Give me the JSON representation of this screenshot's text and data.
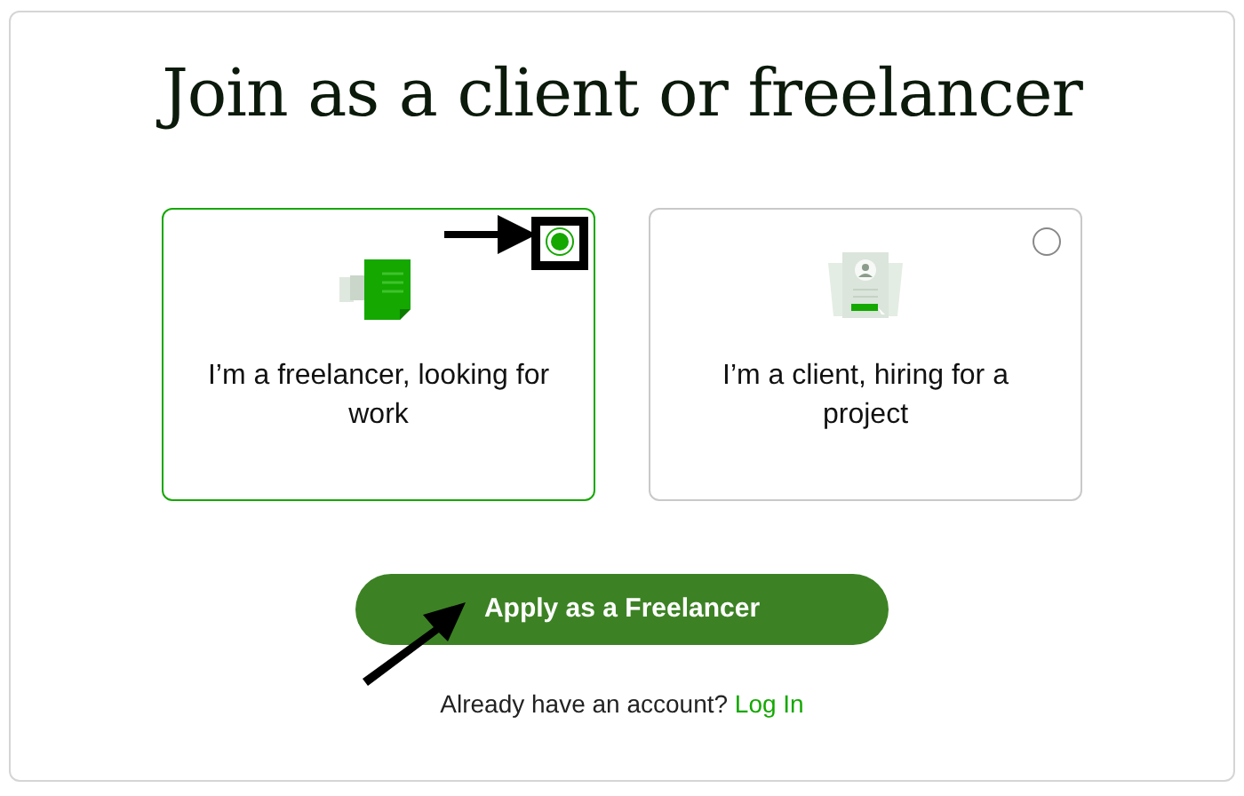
{
  "title": "Join as a client or freelancer",
  "options": [
    {
      "kind": "freelancer",
      "label": "I’m a freelancer, looking for work",
      "selected": true
    },
    {
      "kind": "client",
      "label": "I’m a client, hiring for a project",
      "selected": false
    }
  ],
  "primary_button": "Apply as a Freelancer",
  "footer": {
    "text": "Already have an account?",
    "link": "Log In"
  }
}
